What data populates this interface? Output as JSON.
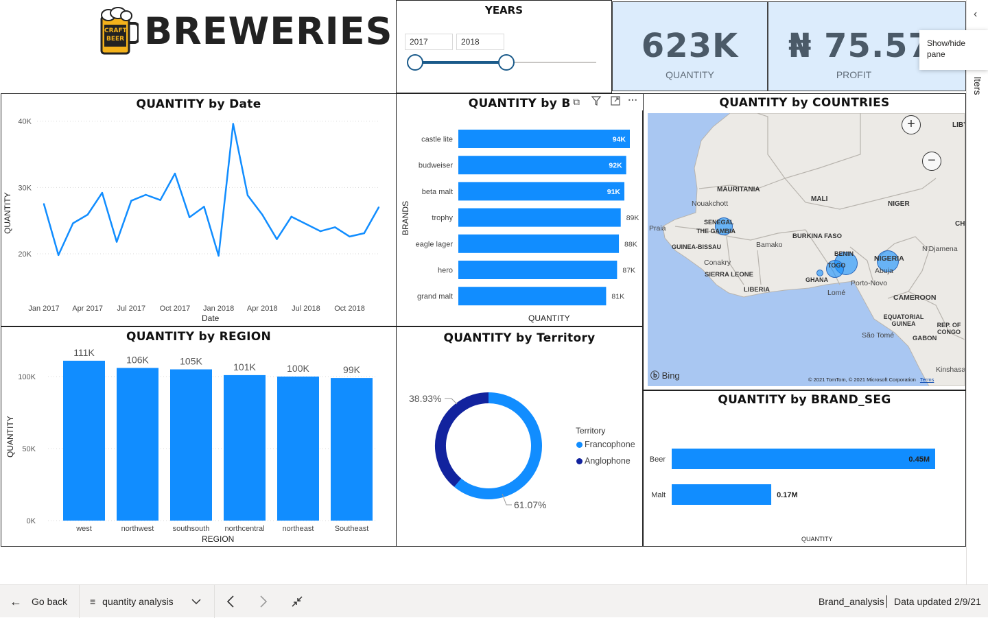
{
  "header": {
    "title": "BREWERIES",
    "logo_text": [
      "CRAFT",
      "BEER"
    ]
  },
  "slicer": {
    "title": "YEARS",
    "start": "2017",
    "end": "2018"
  },
  "kpis": [
    {
      "value": "623K",
      "label": "QUANTITY"
    },
    {
      "value": "₦ 75.57",
      "label": "PROFIT"
    }
  ],
  "tooltip": {
    "text_line1": "Show/hide",
    "text_line2": "pane"
  },
  "filters_tab": {
    "label": "lters"
  },
  "visual_header_icons": [
    "copy-icon",
    "filter-icon",
    "focus-mode-icon",
    "more-options-icon"
  ],
  "colors": {
    "primary": "#118dff",
    "dark": "#12239e",
    "kpi_bg": "#dcecfc"
  },
  "charts": {
    "date": {
      "title": "QUANTITY by Date",
      "xlabel": "Date",
      "ylabel": "QUANTITY",
      "yticks": [
        "40K",
        "30K",
        "20K"
      ],
      "xticks": [
        "Jan 2017",
        "Apr 2017",
        "Jul 2017",
        "Oct 2017",
        "Jan 2018",
        "Apr 2018",
        "Jul 2018",
        "Oct 2018"
      ]
    },
    "brands": {
      "title": "QUANTITY by BRAN",
      "xlabel": "QUANTITY",
      "ylabel": "BRANDS"
    },
    "countries": {
      "title": "QUANTITY by COUNTRIES",
      "bing": "Bing",
      "copyright": "© 2021 TomTom, © 2021 Microsoft Corporation",
      "terms": "Terms",
      "countries": [
        "MAURITANIA",
        "MALI",
        "NIGER",
        "SENEGAL",
        "THE GAMBIA",
        "GUINEA-BISSAU",
        "BURKINA FASO",
        "BENIN",
        "TOGO",
        "NIGERIA",
        "GHANA",
        "SIERRA LEONE",
        "LIBERIA",
        "CAMEROON",
        "EQUATORIAL GUINEA",
        "REP. OF CONGO",
        "GABON",
        "LIBY",
        "CH"
      ],
      "cities": [
        "Nouakchott",
        "Praia",
        "Bamako",
        "Conakry",
        "Abuja",
        "N'Djamena",
        "Porto-Novo",
        "Lomé",
        "São Tomé",
        "Kinshasa"
      ]
    },
    "region": {
      "title": "QUANTITY by REGION",
      "xlabel": "REGION",
      "ylabel": "QUANTITY",
      "yticks": [
        "100K",
        "50K",
        "0K"
      ]
    },
    "territory": {
      "title": "QUANTITY by Territory",
      "legend_title": "Territory",
      "label_anglophone": "38.93%",
      "label_francophone": "61.07%"
    },
    "brand_seg": {
      "title": "QUANTITY by BRAND_SEG",
      "xlabel": "QUANTITY"
    }
  },
  "chart_data": [
    {
      "type": "line",
      "title": "QUANTITY by Date",
      "xlabel": "Date",
      "ylabel": "QUANTITY",
      "ylim": [
        17000,
        41000
      ],
      "x": [
        "Jan 2017",
        "Feb 2017",
        "Mar 2017",
        "Apr 2017",
        "May 2017",
        "Jun 2017",
        "Jul 2017",
        "Aug 2017",
        "Sep 2017",
        "Oct 2017",
        "Nov 2017",
        "Dec 2017",
        "Jan 2018",
        "Feb 2018",
        "Mar 2018",
        "Apr 2018",
        "May 2018",
        "Jun 2018",
        "Jul 2018",
        "Aug 2018",
        "Sep 2018",
        "Oct 2018",
        "Nov 2018",
        "Dec 2018"
      ],
      "series": [
        {
          "values": [
            27500,
            19800,
            24600,
            25900,
            29200,
            21800,
            28000,
            28900,
            28100,
            32100,
            25500,
            27100,
            19700,
            39600,
            28800,
            25900,
            22200,
            25600,
            24500,
            23400,
            24000,
            22600,
            23100,
            27000
          ]
        }
      ]
    },
    {
      "type": "bar",
      "orientation": "horizontal",
      "title": "QUANTITY by BRAN",
      "xlabel": "QUANTITY",
      "ylabel": "BRANDS",
      "categories": [
        "castle lite",
        "budweiser",
        "beta malt",
        "trophy",
        "eagle lager",
        "hero",
        "grand malt"
      ],
      "values": [
        94000,
        92000,
        91000,
        89000,
        88000,
        87000,
        81000
      ],
      "labels": [
        "94K",
        "92K",
        "91K",
        "89K",
        "88K",
        "87K",
        "81K"
      ]
    },
    {
      "type": "bar",
      "title": "QUANTITY by REGION",
      "xlabel": "REGION",
      "ylabel": "QUANTITY",
      "ylim": [
        0,
        120000
      ],
      "categories": [
        "west",
        "northwest",
        "southsouth",
        "northcentral",
        "northeast",
        "Southeast"
      ],
      "values": [
        111000,
        106000,
        105000,
        101000,
        100000,
        99000
      ],
      "labels": [
        "111K",
        "106K",
        "105K",
        "101K",
        "100K",
        "99K"
      ]
    },
    {
      "type": "pie",
      "title": "QUANTITY by Territory",
      "legend": "right",
      "categories": [
        "Francophone",
        "Anglophone"
      ],
      "values": [
        61.07,
        38.93
      ],
      "colors": [
        "#118dff",
        "#12239e"
      ]
    },
    {
      "type": "bar",
      "orientation": "horizontal",
      "title": "QUANTITY by BRAND_SEG",
      "xlabel": "QUANTITY",
      "categories": [
        "Beer",
        "Malt"
      ],
      "values": [
        0.45,
        0.17
      ],
      "labels": [
        "0.45M",
        "0.17M"
      ]
    }
  ],
  "footer": {
    "back": "Go back",
    "page": "quantity analysis",
    "report": "Brand_analysis",
    "updated": "Data updated 2/9/21"
  }
}
